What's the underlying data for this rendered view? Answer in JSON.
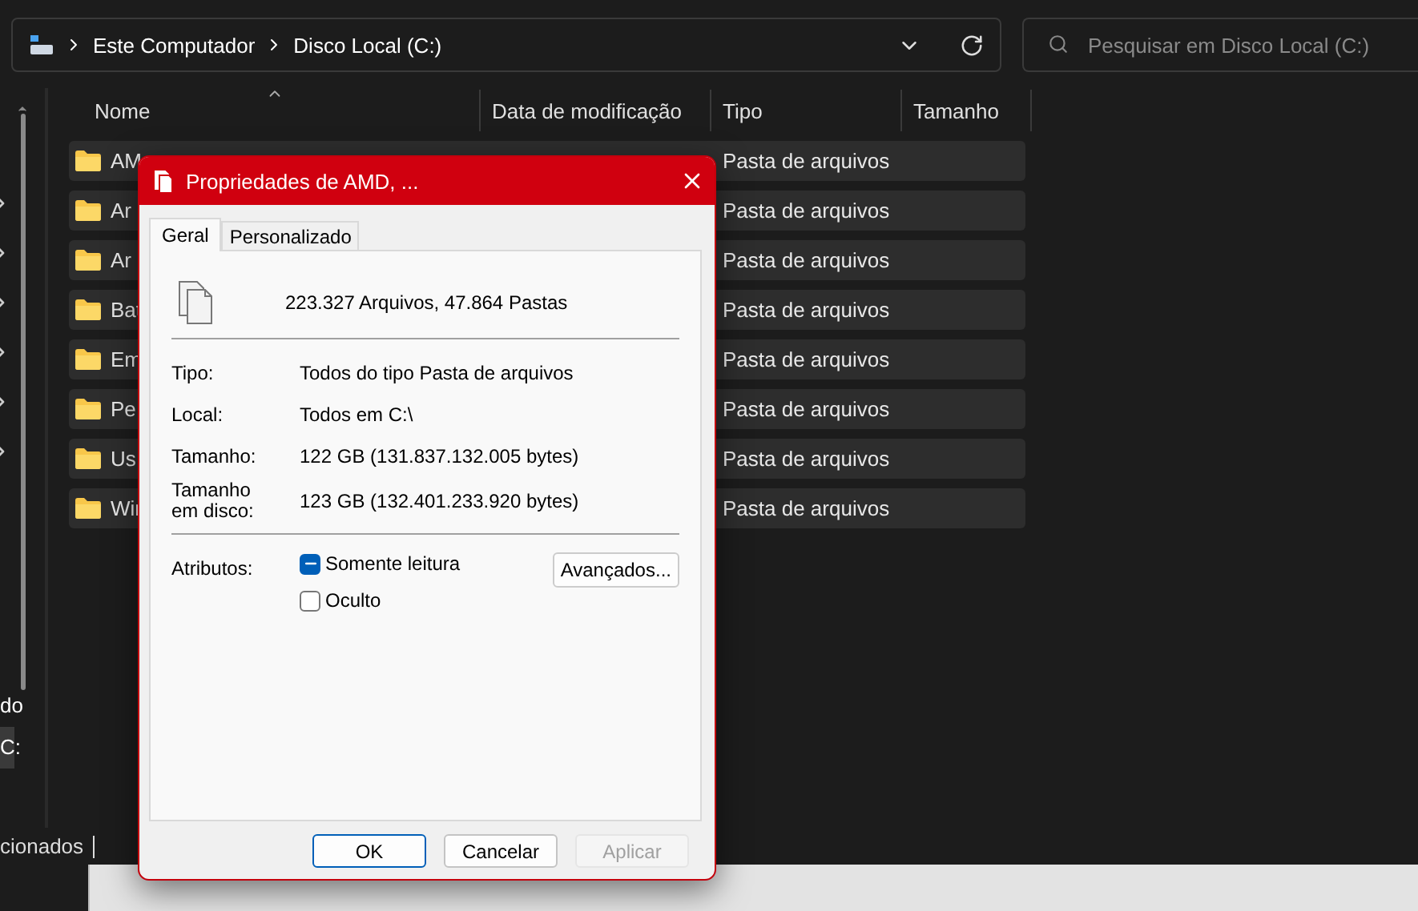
{
  "address_bar": {
    "breadcrumbs": [
      "Este Computador",
      "Disco Local (C:)"
    ]
  },
  "search": {
    "placeholder": "Pesquisar em Disco Local (C:)"
  },
  "columns": [
    {
      "label": "Nome",
      "sorted": true
    },
    {
      "label": "Data de modificação",
      "sorted": false
    },
    {
      "label": "Tipo",
      "sorted": false
    },
    {
      "label": "Tamanho",
      "sorted": false
    }
  ],
  "rows": [
    {
      "name": "AM",
      "type": "Pasta de arquivos"
    },
    {
      "name": "Ar",
      "type": "Pasta de arquivos"
    },
    {
      "name": "Ar",
      "type": "Pasta de arquivos"
    },
    {
      "name": "Bat",
      "type": "Pasta de arquivos"
    },
    {
      "name": "Em",
      "type": "Pasta de arquivos"
    },
    {
      "name": "Pe",
      "type": "Pasta de arquivos"
    },
    {
      "name": "Us",
      "type": "Pasta de arquivos"
    },
    {
      "name": "Wir",
      "type": "Pasta de arquivos"
    }
  ],
  "navigation_pane": {
    "items": [
      {
        "label": "do",
        "selected": false
      },
      {
        "label": "C:",
        "selected": true
      }
    ]
  },
  "status_bar": {
    "text": "cionados"
  },
  "dialog": {
    "title": "Propriedades de AMD, ...",
    "tabs": [
      {
        "label": "Geral",
        "selected": true
      },
      {
        "label": "Personalizado",
        "selected": false
      }
    ],
    "summary": "223.327 Arquivos, 47.864 Pastas",
    "properties": [
      {
        "label": "Tipo:",
        "value": "Todos do tipo Pasta de arquivos"
      },
      {
        "label": "Local:",
        "value": "Todos em C:\\"
      },
      {
        "label": "Tamanho:",
        "value": "122 GB (131.837.132.005 bytes)"
      },
      {
        "label": "Tamanho em disco:",
        "value": "123 GB (132.401.233.920 bytes)"
      }
    ],
    "attributes": {
      "label": "Atributos:",
      "options": [
        {
          "label": "Somente leitura",
          "indeterminate": true
        },
        {
          "label": "Oculto",
          "indeterminate": false
        }
      ]
    },
    "advanced_button": "Avançados...",
    "buttons": [
      {
        "label": "OK",
        "default": true,
        "disabled": false
      },
      {
        "label": "Cancelar",
        "default": false,
        "disabled": false
      },
      {
        "label": "Aplicar",
        "default": false,
        "disabled": true
      }
    ]
  }
}
